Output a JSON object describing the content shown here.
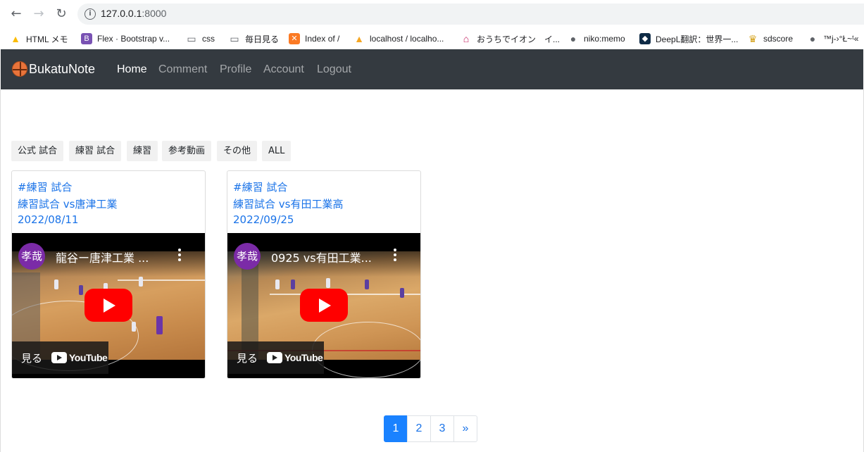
{
  "browser": {
    "url_host": "127.0.0.1",
    "url_port": ":8000",
    "bookmarks": [
      {
        "label": "HTML メモ",
        "icon": "google-drive-icon",
        "color": "#fbbc04"
      },
      {
        "label": "Flex · Bootstrap v...",
        "icon": "bootstrap-icon",
        "color": "#7952b3"
      },
      {
        "label": "css",
        "icon": "folder-icon",
        "color": "#5f6368"
      },
      {
        "label": "毎日見る",
        "icon": "folder-icon",
        "color": "#5f6368"
      },
      {
        "label": "Index of /",
        "icon": "xampp-icon",
        "color": "#fb7a24"
      },
      {
        "label": "localhost / localho...",
        "icon": "phpmyadmin-icon",
        "color": "#f5a623"
      },
      {
        "label": "おうちでイオン　イ...",
        "icon": "home-icon",
        "color": "#c2185b"
      },
      {
        "label": "niko:memo",
        "icon": "globe-icon",
        "color": "#5f6368"
      },
      {
        "label": "DeepL翻訳：世界一...",
        "icon": "deepl-icon",
        "color": "#0f2b46"
      },
      {
        "label": "sdscore",
        "icon": "crown-icon",
        "color": "#d4a017"
      },
      {
        "label": "™j-›°Ł~ᵗ«",
        "icon": "globe-icon",
        "color": "#5f6368"
      }
    ]
  },
  "navbar": {
    "brand": "BukatuNote",
    "links": [
      {
        "label": "Home",
        "active": true
      },
      {
        "label": "Comment",
        "active": false
      },
      {
        "label": "Profile",
        "active": false
      },
      {
        "label": "Account",
        "active": false
      },
      {
        "label": "Logout",
        "active": false
      }
    ]
  },
  "categories": [
    "公式 試合",
    "練習 試合",
    "練習",
    "参考動画",
    "その他",
    "ALL"
  ],
  "posts": [
    {
      "tag": "#練習 試合",
      "title": "練習試合 vs唐津工業",
      "date": "2022/08/11",
      "video": {
        "channel_avatar": "孝哉",
        "title": "龍谷ー唐津工業 ...",
        "watch_label": "見る",
        "brand": "YouTube"
      }
    },
    {
      "tag": "#練習 試合",
      "title": "練習試合 vs有田工業高",
      "date": "2022/09/25",
      "video": {
        "channel_avatar": "孝哉",
        "title": "0925 vs有田工業...",
        "watch_label": "見る",
        "brand": "YouTube"
      }
    }
  ],
  "pagination": {
    "pages": [
      "1",
      "2",
      "3"
    ],
    "current": "1",
    "next": "»"
  },
  "colors": {
    "navbar_bg": "#343a40",
    "link": "#1a73e8",
    "page_active": "#1a82ff",
    "play_button": "#ff0000",
    "avatar": "#7b2ba7"
  }
}
